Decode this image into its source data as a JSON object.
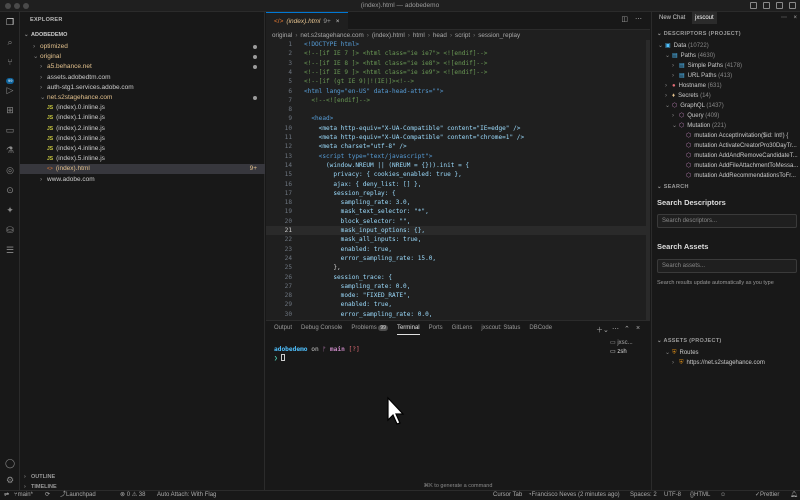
{
  "window": {
    "title": "(index).html — adobedemo"
  },
  "explorer": {
    "title": "EXPLORER",
    "root": "ADOBEDEMO",
    "rows": [
      {
        "label": "optimized",
        "depth": 1,
        "kind": "folder",
        "color": "yellow",
        "dot": true
      },
      {
        "label": "original",
        "depth": 1,
        "kind": "folder-open",
        "color": "yellow",
        "dot": true
      },
      {
        "label": "a5.behance.net",
        "depth": 2,
        "kind": "folder",
        "color": "yellow",
        "dot": true
      },
      {
        "label": "assets.adobedtm.com",
        "depth": 2,
        "kind": "folder",
        "color": "plain",
        "dot": false
      },
      {
        "label": "auth-stg1.services.adobe.com",
        "depth": 2,
        "kind": "folder",
        "color": "plain",
        "dot": false
      },
      {
        "label": "net.s2stagehance.com",
        "depth": 2,
        "kind": "folder-open",
        "color": "yellow",
        "dot": true
      },
      {
        "label": "(index).0.inline.js",
        "depth": 3,
        "kind": "js",
        "color": "plain",
        "dot": false
      },
      {
        "label": "(index).1.inline.js",
        "depth": 3,
        "kind": "js",
        "color": "plain",
        "dot": false
      },
      {
        "label": "(index).2.inline.js",
        "depth": 3,
        "kind": "js",
        "color": "plain",
        "dot": false
      },
      {
        "label": "(index).3.inline.js",
        "depth": 3,
        "kind": "js",
        "color": "plain",
        "dot": false
      },
      {
        "label": "(index).4.inline.js",
        "depth": 3,
        "kind": "js",
        "color": "plain",
        "dot": false
      },
      {
        "label": "(index).5.inline.js",
        "depth": 3,
        "kind": "js",
        "color": "plain",
        "dot": false
      },
      {
        "label": "(index).html",
        "depth": 3,
        "kind": "html",
        "color": "yellow",
        "dot": false,
        "badge": "9+",
        "selected": true
      },
      {
        "label": "www.adobe.com",
        "depth": 2,
        "kind": "folder",
        "color": "plain",
        "dot": false
      }
    ],
    "outline": "OUTLINE",
    "timeline": "TIMELINE"
  },
  "editor": {
    "tab": {
      "label": "(index).html",
      "modified": "9+"
    },
    "breadcrumb": [
      "original",
      "net.s2stagehance.com",
      "(index).html",
      "html",
      "head",
      "script",
      "session_replay"
    ],
    "current_line": 21,
    "lines": [
      {
        "n": "1",
        "text": "<!DOCTYPE html>",
        "cls": "c-tag"
      },
      {
        "n": "2",
        "text": "<!--[if IE 7 ]> <html class=\"ie ie7\"> <![endif]-->",
        "cls": "c-com"
      },
      {
        "n": "3",
        "text": "<!--[if IE 8 ]> <html class=\"ie ie8\"> <![endif]-->",
        "cls": "c-com"
      },
      {
        "n": "4",
        "text": "<!--[if IE 9 ]> <html class=\"ie ie9\"> <![endif]-->",
        "cls": "c-com"
      },
      {
        "n": "5",
        "text": "<!--[if (gt IE 9)|!(IE)]><!-->",
        "cls": "c-com"
      },
      {
        "n": "6",
        "text": "<html lang=\"en-US\" data-head-attrs=\"\">",
        "cls": "c-tag"
      },
      {
        "n": "7",
        "text": "  <!--<![endif]-->",
        "cls": "c-com"
      },
      {
        "n": "8",
        "text": "",
        "cls": "c-def"
      },
      {
        "n": "9",
        "text": "  <head>",
        "cls": "c-tag"
      },
      {
        "n": "10",
        "text": "    <meta http-equiv=\"X-UA-Compatible\" content=\"IE=edge\" />",
        "cls": "c-attr"
      },
      {
        "n": "11",
        "text": "    <meta http-equiv=\"X-UA-Compatible\" content=\"chrome=1\" />",
        "cls": "c-attr"
      },
      {
        "n": "12",
        "text": "    <meta charset=\"utf-8\" />",
        "cls": "c-attr"
      },
      {
        "n": "13",
        "text": "    <script type=\"text/javascript\">",
        "cls": "c-tag"
      },
      {
        "n": "14",
        "text": "      (window.NREUM || (NREUM = {})).init = {",
        "cls": "c-attr"
      },
      {
        "n": "15",
        "text": "        privacy: { cookies_enabled: true },",
        "cls": "c-attr"
      },
      {
        "n": "16",
        "text": "        ajax: { deny_list: [] },",
        "cls": "c-attr"
      },
      {
        "n": "17",
        "text": "        session_replay: {",
        "cls": "c-attr"
      },
      {
        "n": "18",
        "text": "          sampling_rate: 3.0,",
        "cls": "c-attr"
      },
      {
        "n": "19",
        "text": "          mask_text_selector: \"*\",",
        "cls": "c-attr"
      },
      {
        "n": "20",
        "text": "          block_selector: \"\",",
        "cls": "c-attr"
      },
      {
        "n": "21",
        "text": "          mask_input_options: {},",
        "cls": "c-attr"
      },
      {
        "n": "22",
        "text": "          mask_all_inputs: true,",
        "cls": "c-attr"
      },
      {
        "n": "23",
        "text": "          enabled: true,",
        "cls": "c-attr"
      },
      {
        "n": "24",
        "text": "          error_sampling_rate: 15.0,",
        "cls": "c-attr"
      },
      {
        "n": "25",
        "text": "        },",
        "cls": "c-def"
      },
      {
        "n": "26",
        "text": "        session_trace: {",
        "cls": "c-attr"
      },
      {
        "n": "27",
        "text": "          sampling_rate: 0.0,",
        "cls": "c-attr"
      },
      {
        "n": "28",
        "text": "          mode: \"FIXED_RATE\",",
        "cls": "c-attr"
      },
      {
        "n": "29",
        "text": "          enabled: true,",
        "cls": "c-attr"
      },
      {
        "n": "30",
        "text": "          error_sampling_rate: 0.0,",
        "cls": "c-attr"
      }
    ]
  },
  "panel": {
    "tabs": [
      {
        "label": "Output",
        "active": false
      },
      {
        "label": "Debug Console",
        "active": false
      },
      {
        "label": "Problems",
        "active": false,
        "count": "99"
      },
      {
        "label": "Terminal",
        "active": true
      },
      {
        "label": "Ports",
        "active": false
      },
      {
        "label": "GitLens",
        "active": false
      },
      {
        "label": "jxscout: Status",
        "active": false
      },
      {
        "label": "DBCode",
        "active": false
      }
    ],
    "prompt": {
      "dir": "adobedemo",
      "on": "on",
      "branch_icon": "ᚠ",
      "branch": "main",
      "status": "[?]",
      "cursor": "❯"
    },
    "terminals": [
      "jxsc...",
      "zsh"
    ],
    "hint": "⌘K to generate a command"
  },
  "right": {
    "tabs": [
      "New Chat",
      "jxscout"
    ],
    "descriptors_title": "DESCRIPTORS (PROJECT)",
    "descriptors": [
      {
        "label": "Data",
        "count": "(10722)",
        "depth": 0,
        "icon": "▣",
        "icls": "ico-blue"
      },
      {
        "label": "Paths",
        "count": "(4630)",
        "depth": 1,
        "icon": "▤",
        "icls": "ico-blue"
      },
      {
        "label": "Simple Paths",
        "count": "(4178)",
        "depth": 2,
        "icon": "▤",
        "icls": "ico-blue"
      },
      {
        "label": "URL Paths",
        "count": "(413)",
        "depth": 2,
        "icon": "▤",
        "icls": "ico-blue"
      },
      {
        "label": "Hostname",
        "count": "(631)",
        "depth": 1,
        "icon": "●",
        "icls": "ico-red"
      },
      {
        "label": "Secrets",
        "count": "(14)",
        "depth": 1,
        "icon": "♦",
        "icls": "ico-yel"
      },
      {
        "label": "GraphQL",
        "count": "(1437)",
        "depth": 1,
        "icon": "⬡",
        "icls": "ico-pink"
      },
      {
        "label": "Query",
        "count": "(409)",
        "depth": 2,
        "icon": "⬡",
        "icls": "ico-pink"
      },
      {
        "label": "Mutation",
        "count": "(221)",
        "depth": 2,
        "icon": "⬡",
        "icls": "ico-pink"
      },
      {
        "label": "mutation AcceptInvitation($id: Int!) {",
        "count": "",
        "depth": 3,
        "icon": "⬡",
        "icls": "ico-pink"
      },
      {
        "label": "mutation ActivateCreatorPro30DayTr...",
        "count": "",
        "depth": 3,
        "icon": "⬡",
        "icls": "ico-pink"
      },
      {
        "label": "mutation AddAndRemoveCandidateT...",
        "count": "",
        "depth": 3,
        "icon": "⬡",
        "icls": "ico-pink"
      },
      {
        "label": "mutation AddFileAttachmentToMessa...",
        "count": "",
        "depth": 3,
        "icon": "⬡",
        "icls": "ico-pink"
      },
      {
        "label": "mutation AddRecommendationsToFr...",
        "count": "",
        "depth": 3,
        "icon": "⬡",
        "icls": "ico-pink"
      }
    ],
    "search_title": "SEARCH",
    "search_descriptors_heading": "Search Descriptors",
    "search_descriptors_placeholder": "Search descriptors...",
    "search_assets_heading": "Search Assets",
    "search_assets_placeholder": "Search assets...",
    "search_note": "Search results update automatically as you type",
    "assets_title": "ASSETS (PROJECT)",
    "assets": [
      {
        "label": "Routes",
        "depth": 1
      },
      {
        "label": "https://net.s2stagehance.com",
        "depth": 2
      }
    ]
  },
  "status": {
    "branch": "main*",
    "sync": "⟳",
    "launch": "Launchpad",
    "problems": "⊗ 0 ⚠ 38",
    "autoattach": "Auto Attach: With Flag",
    "cursor_tab": "Cursor Tab",
    "blame": "Francisco Neves (2 minutes ago)",
    "spaces": "Spaces: 2",
    "encoding": "UTF-8",
    "lang": "HTML",
    "prettier": "Prettier"
  }
}
